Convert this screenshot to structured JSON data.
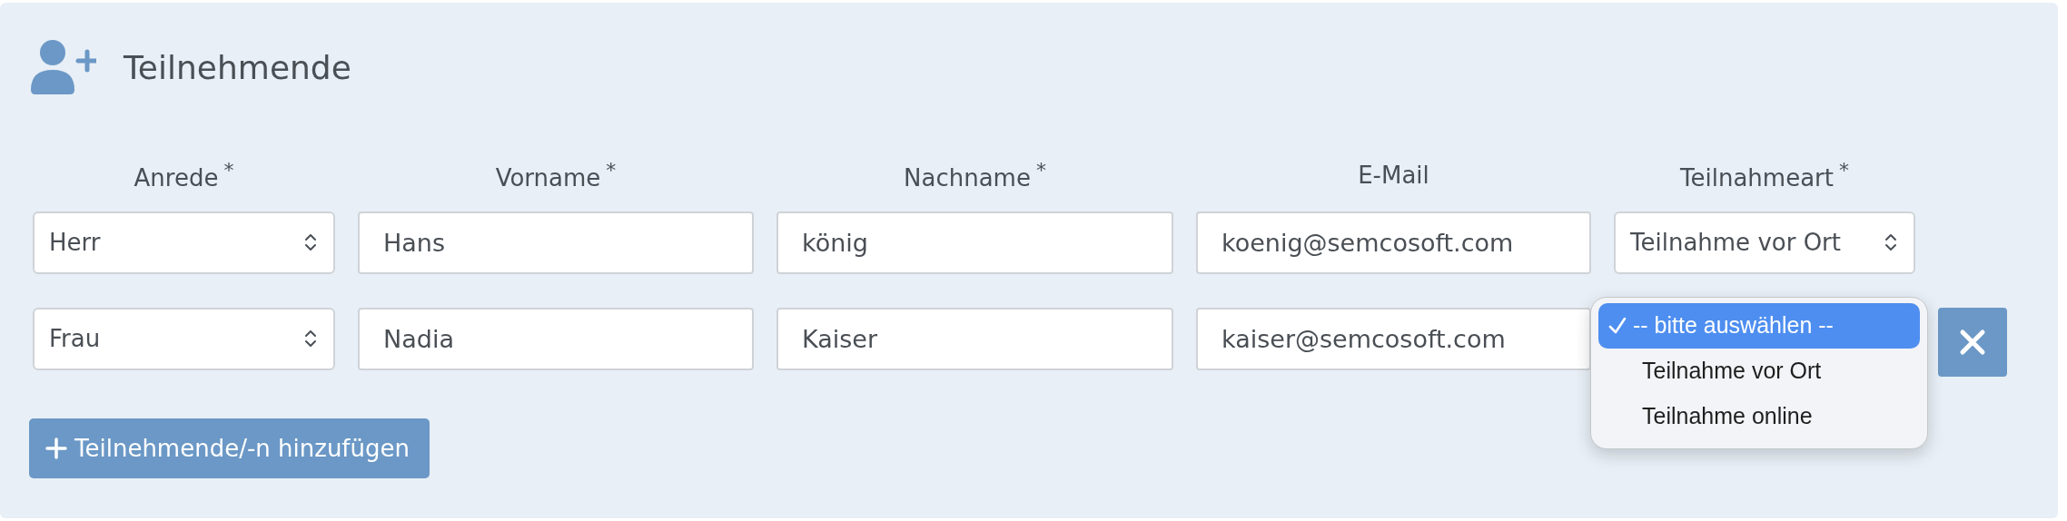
{
  "section": {
    "title": "Teilnehmende"
  },
  "columns": [
    {
      "label": "Anrede",
      "marker": "*"
    },
    {
      "label": "Vorname",
      "marker": "*"
    },
    {
      "label": "Nachname",
      "marker": "*"
    },
    {
      "label": "E-Mail"
    },
    {
      "label": "Teilnahmeart",
      "marker": "*"
    }
  ],
  "rows": [
    {
      "anrede": "Herr",
      "vorname": "Hans",
      "nachname": "könig",
      "email": "koenig@semcosoft.com",
      "teilnahmeart": "Teilnahme vor Ort",
      "removable": false
    },
    {
      "anrede": "Frau",
      "vorname": "Nadia",
      "nachname": "Kaiser",
      "email": "kaiser@semcosoft.com",
      "removable": true,
      "open_menu": [
        {
          "label": "-- bitte auswählen --",
          "selected": true
        },
        {
          "label": "Teilnahme vor Ort",
          "selected": false
        },
        {
          "label": "Teilnahme online",
          "selected": false
        }
      ]
    }
  ],
  "add_button": {
    "label": "Teilnehmende/-n hinzufügen"
  }
}
